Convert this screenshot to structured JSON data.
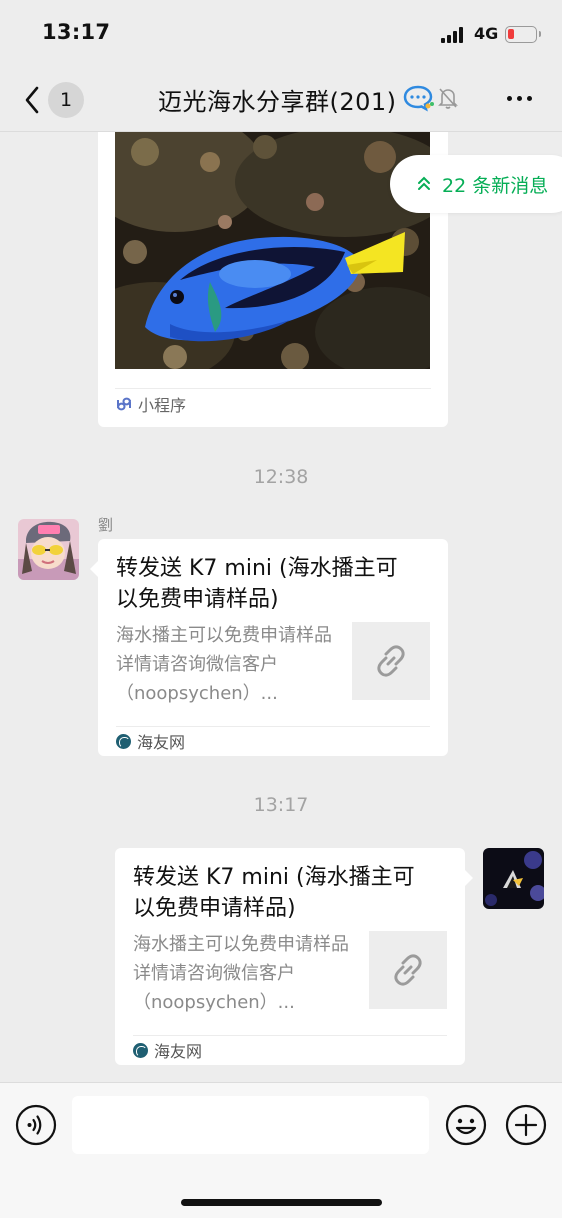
{
  "status_bar": {
    "time": "13:17",
    "network": "4G"
  },
  "nav": {
    "unread_count": "1",
    "title": "迈光海水分享群(201)"
  },
  "mini_program": {
    "footer_label": "小程序"
  },
  "new_messages": {
    "label": "22 条新消息"
  },
  "timestamps": [
    "12:38",
    "13:17"
  ],
  "messages": [
    {
      "sender": "劉",
      "title": "转发送 K7 mini (海水播主可以免费申请样品)",
      "description": "海水播主可以免费申请样品详情请咨询微信客户（noopsychen）...",
      "source": "海友网"
    },
    {
      "sender": "",
      "title": "转发送 K7 mini (海水播主可以免费申请样品)",
      "description": "海水播主可以免费申请样品详情请咨询微信客户（noopsychen）...",
      "source": "海友网"
    }
  ],
  "input": {
    "placeholder": ""
  },
  "colors": {
    "accent_green": "#06ae56",
    "battery_low": "#f03c3c",
    "background": "#ededed"
  }
}
